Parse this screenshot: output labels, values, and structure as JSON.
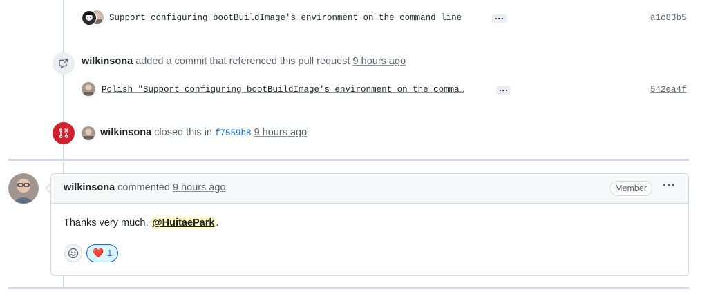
{
  "commits": [
    {
      "message": "Support configuring bootBuildImage's environment on the command line",
      "sha": "a1c83b5"
    },
    {
      "message": "Polish \"Support configuring bootBuildImage's environment on the comma…",
      "sha": "542ea4f"
    }
  ],
  "reference_event": {
    "user": "wilkinsona",
    "text": "added a commit that referenced this pull request",
    "time": "9 hours ago",
    "icon": "cross-reference-icon"
  },
  "closed_event": {
    "user": "wilkinsona",
    "text_before": "closed this in",
    "commit": "f7559b8",
    "time": "9 hours ago",
    "icon": "git-pull-request-closed-icon",
    "icon_color": "#cf222e"
  },
  "comment": {
    "author": "wilkinsona",
    "action": "commented",
    "time": "9 hours ago",
    "badge": "Member",
    "body_prefix": "Thanks very much,",
    "mention": "@HuitaePark",
    "body_suffix": ".",
    "reactions": [
      {
        "emoji": "❤️",
        "count": "1"
      }
    ]
  },
  "colors": {
    "accent": "#0969da",
    "closed": "#cf222e",
    "mention_bg": "#fff8c5"
  }
}
